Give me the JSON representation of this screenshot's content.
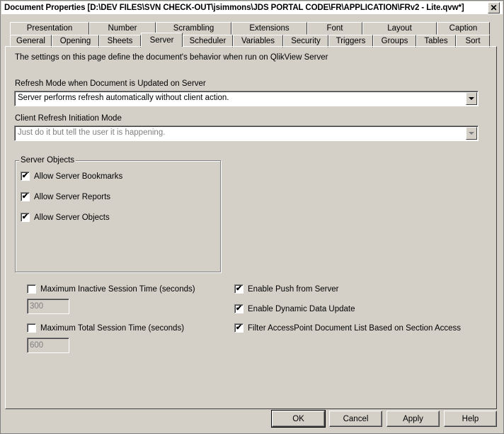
{
  "window": {
    "title": "Document Properties [D:\\DEV FILES\\SVN CHECK-OUT\\jsimmons\\JDS PORTAL CODE\\FR\\APPLICATION\\FRv2 - Lite.qvw*]",
    "close_label": "✕"
  },
  "tabs_row1": [
    "Presentation",
    "Number",
    "Scrambling",
    "Extensions",
    "Font",
    "Layout",
    "Caption"
  ],
  "tabs_row2": [
    "General",
    "Opening",
    "Sheets",
    "Server",
    "Scheduler",
    "Variables",
    "Security",
    "Triggers",
    "Groups",
    "Tables",
    "Sort"
  ],
  "active_tab": "Server",
  "server": {
    "description": "The settings on this page define the document's behavior when run on QlikView Server",
    "refresh_mode_label": "Refresh Mode when Document is Updated on Server",
    "refresh_mode_value": "Server performs refresh automatically without client action.",
    "client_refresh_label": "Client Refresh Initiation Mode",
    "client_refresh_value": "Just do it but tell the user it is happening.",
    "server_objects_title": "Server Objects",
    "allow_bookmarks": {
      "label": "Allow Server Bookmarks",
      "checked": true
    },
    "allow_reports": {
      "label": "Allow Server Reports",
      "checked": true
    },
    "allow_objects": {
      "label": "Allow Server Objects",
      "checked": true
    },
    "max_inactive": {
      "label": "Maximum Inactive Session Time (seconds)",
      "checked": false,
      "value": "300"
    },
    "max_total": {
      "label": "Maximum Total Session Time (seconds)",
      "checked": false,
      "value": "600"
    },
    "enable_push": {
      "label": "Enable Push from Server",
      "checked": true
    },
    "enable_dynamic": {
      "label": "Enable Dynamic Data Update",
      "checked": true
    },
    "filter_accesspoint": {
      "label": "Filter AccessPoint Document List Based on Section Access",
      "checked": true
    }
  },
  "buttons": {
    "ok": "OK",
    "cancel": "Cancel",
    "apply": "Apply",
    "help": "Help"
  },
  "check_glyph": "✔"
}
